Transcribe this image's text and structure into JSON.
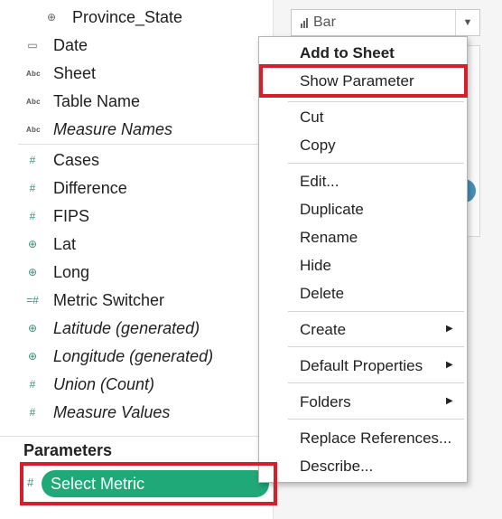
{
  "fields": {
    "province_state": "Province_State",
    "date": "Date",
    "sheet": "Sheet",
    "table_name": "Table Name",
    "measure_names": "Measure Names",
    "cases": "Cases",
    "difference": "Difference",
    "fips": "FIPS",
    "lat": "Lat",
    "long": "Long",
    "metric_switcher": "Metric Switcher",
    "latitude_generated": "Latitude (generated)",
    "longitude_generated": "Longitude (generated)",
    "union_count": "Union (Count)",
    "measure_values": "Measure Values"
  },
  "icons": {
    "abc": "Abc",
    "hash": "#",
    "globe": "⊕",
    "calendar": "▭"
  },
  "parameters": {
    "header": "Parameters",
    "select_metric": "Select Metric"
  },
  "marks": {
    "type": "Bar"
  },
  "context_menu": {
    "add_to_sheet": "Add to Sheet",
    "show_parameter": "Show Parameter",
    "cut": "Cut",
    "copy": "Copy",
    "edit": "Edit...",
    "duplicate": "Duplicate",
    "rename": "Rename",
    "hide": "Hide",
    "delete": "Delete",
    "create": "Create",
    "default_properties": "Default Properties",
    "folders": "Folders",
    "replace_references": "Replace References...",
    "describe": "Describe..."
  },
  "colors": {
    "parameter_pill": "#1fa979",
    "highlight_box": "#d71f2c",
    "measure_icon": "#3d8f72"
  }
}
